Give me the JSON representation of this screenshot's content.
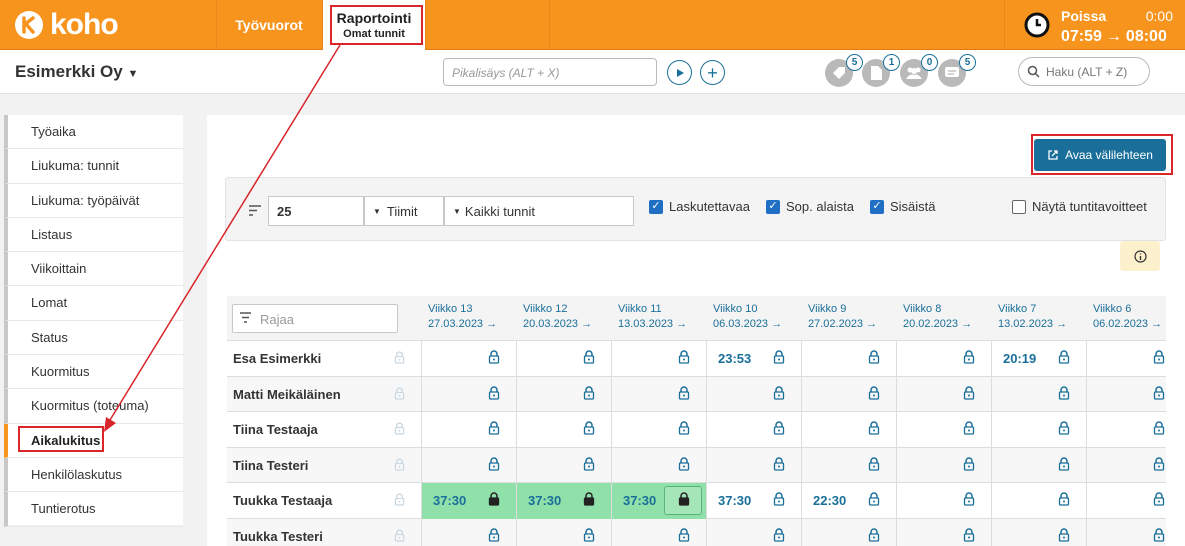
{
  "app": {
    "logo_text": "koho"
  },
  "nav": {
    "tab1": "Työvuorot",
    "tab2": "Raportointi",
    "tab2_sub": "Omat tunnit"
  },
  "absence": {
    "label": "Poissa",
    "time": "0:00",
    "start": "07:59",
    "arrow": "→",
    "end": "08:00"
  },
  "header": {
    "company": "Esimerkki Oy",
    "quick_placeholder": "Pikalisäys (ALT + X)",
    "search_placeholder": "Haku (ALT + Z)",
    "notifications": [
      {
        "icon": "tag-icon",
        "count": "5"
      },
      {
        "icon": "document-icon",
        "count": "1"
      },
      {
        "icon": "people-icon",
        "count": "0"
      },
      {
        "icon": "message-icon",
        "count": "5"
      }
    ]
  },
  "sidebar": {
    "items": [
      {
        "label": "Työaika"
      },
      {
        "label": "Liukuma: tunnit"
      },
      {
        "label": "Liukuma: työpäivät"
      },
      {
        "label": "Listaus"
      },
      {
        "label": "Viikoittain"
      },
      {
        "label": "Lomat"
      },
      {
        "label": "Status"
      },
      {
        "label": "Kuormitus"
      },
      {
        "label": "Kuormitus (toteuma)"
      },
      {
        "label": "Aikalukitus"
      },
      {
        "label": "Henkilölaskutus"
      },
      {
        "label": "Tuntierotus"
      }
    ],
    "active_index": 9
  },
  "main": {
    "open_tab_label": "Avaa välilehteen",
    "filters": {
      "count": "25",
      "teams_label": "Tiimit",
      "hours_label": "Kaikki tunnit",
      "checkboxes": [
        {
          "label": "Laskutettavaa",
          "checked": true
        },
        {
          "label": "Sop. alaista",
          "checked": true
        },
        {
          "label": "Sisäistä",
          "checked": true
        },
        {
          "label": "Näytä tuntitavoitteet",
          "checked": false
        }
      ]
    },
    "filter_placeholder": "Rajaa",
    "weeks": [
      {
        "label": "Viikko 13",
        "date": "27.03.2023 →"
      },
      {
        "label": "Viikko 12",
        "date": "20.03.2023 →"
      },
      {
        "label": "Viikko 11",
        "date": "13.03.2023 →"
      },
      {
        "label": "Viikko 10",
        "date": "06.03.2023 →"
      },
      {
        "label": "Viikko 9",
        "date": "27.02.2023 →"
      },
      {
        "label": "Viikko 8",
        "date": "20.02.2023 →"
      },
      {
        "label": "Viikko 7",
        "date": "13.02.2023 →"
      },
      {
        "label": "Viikko 6",
        "date": "06.02.2023 →"
      }
    ],
    "rows": [
      {
        "name": "Esa Esimerkki",
        "cells": [
          "",
          "",
          "",
          "23:53",
          "",
          "",
          "20:19",
          ""
        ]
      },
      {
        "name": "Matti Meikäläinen",
        "cells": [
          "",
          "",
          "",
          "",
          "",
          "",
          "",
          ""
        ]
      },
      {
        "name": "Tiina Testaaja",
        "cells": [
          "",
          "",
          "",
          "",
          "",
          "",
          "",
          ""
        ]
      },
      {
        "name": "Tiina Testeri",
        "cells": [
          "",
          "",
          "",
          "",
          "",
          "",
          "",
          ""
        ]
      },
      {
        "name": "Tuukka Testaaja",
        "cells": [
          "37:30",
          "37:30",
          "37:30",
          "37:30",
          "22:30",
          "",
          "",
          ""
        ],
        "locked": [
          true,
          true,
          true,
          false,
          false,
          false,
          false,
          false
        ]
      },
      {
        "name": "Tuukka Testeri",
        "cells": [
          "",
          "",
          "",
          "",
          "",
          "",
          "",
          ""
        ]
      }
    ]
  },
  "colors": {
    "brand": "#f7941d",
    "accent": "#1a6f9a",
    "locked_green": "#8fe0a9",
    "annotation_red": "#d8262b"
  }
}
